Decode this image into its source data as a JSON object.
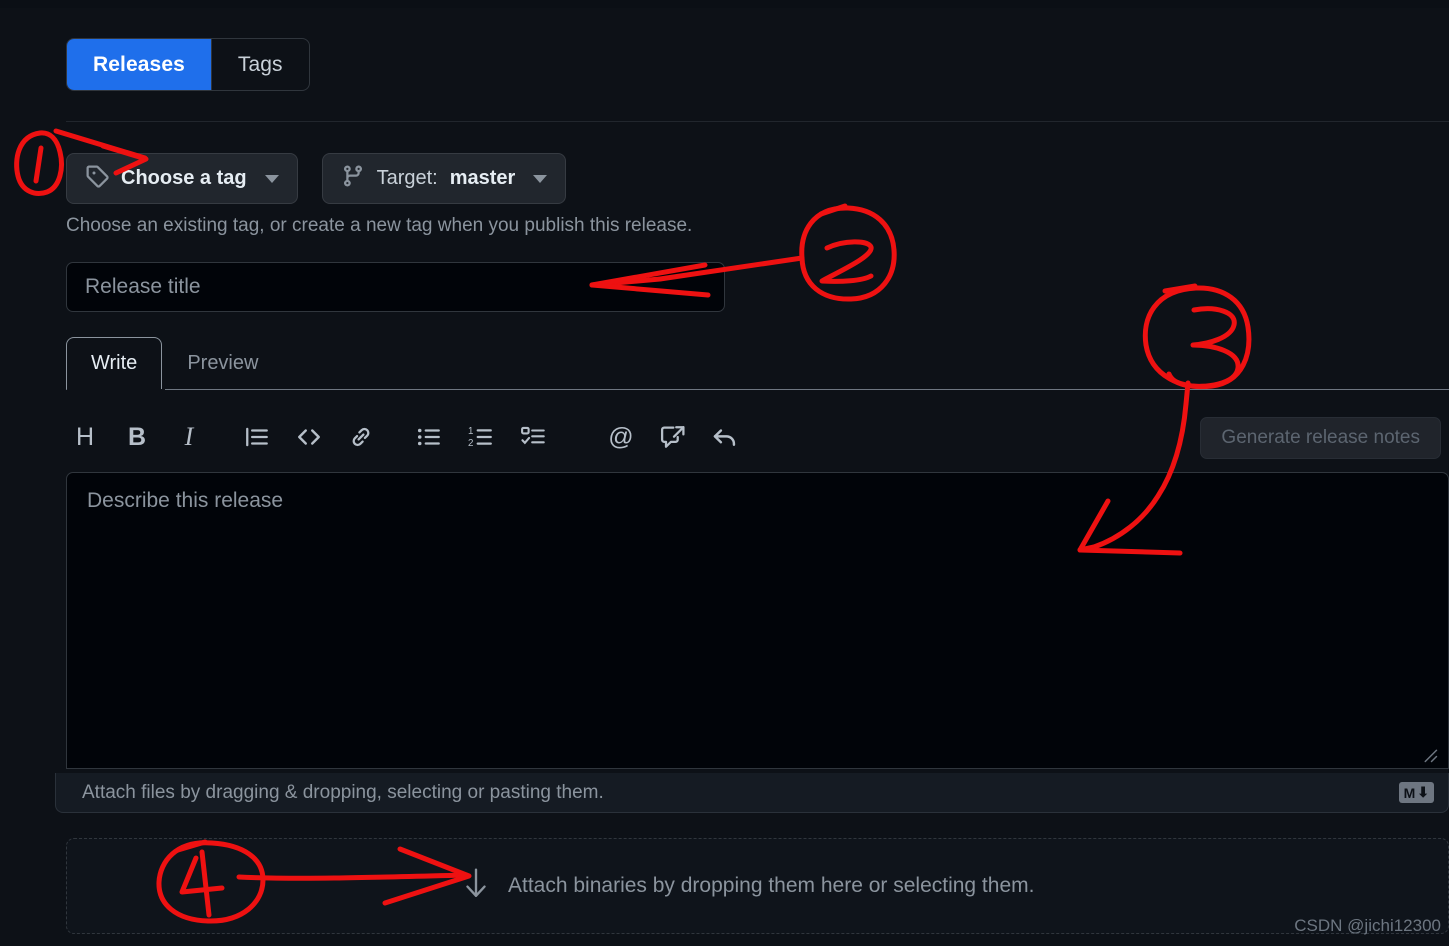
{
  "page": {
    "background": "#0d1117",
    "accent": "#1f6feb",
    "annotation_color": "#ee1111",
    "watermark": "CSDN @jichi12300"
  },
  "tabs_top": {
    "items": [
      {
        "label": "Releases",
        "active": true
      },
      {
        "label": "Tags",
        "active": false
      }
    ]
  },
  "controls": {
    "choose_tag": {
      "label": "Choose a tag",
      "icon": "tag-icon",
      "caret": "chevron-down-icon"
    },
    "target": {
      "prefix": "Target:",
      "value": "master",
      "icon": "git-branch-icon",
      "caret": "chevron-down-icon"
    },
    "helper": "Choose an existing tag, or create a new tag when you publish this release."
  },
  "release_title": {
    "value": "",
    "placeholder": "Release title"
  },
  "editor": {
    "tabs": [
      {
        "label": "Write",
        "active": true
      },
      {
        "label": "Preview",
        "active": false
      }
    ],
    "toolbar": [
      {
        "name": "heading-icon",
        "glyph": "H"
      },
      {
        "name": "bold-icon",
        "glyph": "B"
      },
      {
        "name": "italic-icon",
        "glyph": "I"
      },
      {
        "name": "quote-icon",
        "glyph": ""
      },
      {
        "name": "code-icon",
        "glyph": "<>"
      },
      {
        "name": "link-icon",
        "glyph": ""
      },
      {
        "name": "unordered-list-icon",
        "glyph": ""
      },
      {
        "name": "ordered-list-icon",
        "glyph": ""
      },
      {
        "name": "task-list-icon",
        "glyph": ""
      },
      {
        "name": "mention-icon",
        "glyph": "@"
      },
      {
        "name": "cross-reference-icon",
        "glyph": ""
      },
      {
        "name": "reply-icon",
        "glyph": ""
      }
    ],
    "generate_notes_label": "Generate release notes",
    "generate_notes_disabled": true,
    "body": {
      "value": "",
      "placeholder": "Describe this release"
    },
    "footer_text": "Attach files by dragging & dropping, selecting or pasting them.",
    "markdown_badge": "M",
    "resize_handle": "resize-grip-icon"
  },
  "dropzone": {
    "icon": "download-arrow-icon",
    "text": "Attach binaries by dropping them here or selecting them."
  },
  "annotations": [
    {
      "number": "1",
      "target": "choose-a-tag-button"
    },
    {
      "number": "2",
      "target": "release-title-input"
    },
    {
      "number": "3",
      "target": "describe-this-release-textarea"
    },
    {
      "number": "4",
      "target": "attach-binaries-dropzone"
    }
  ]
}
